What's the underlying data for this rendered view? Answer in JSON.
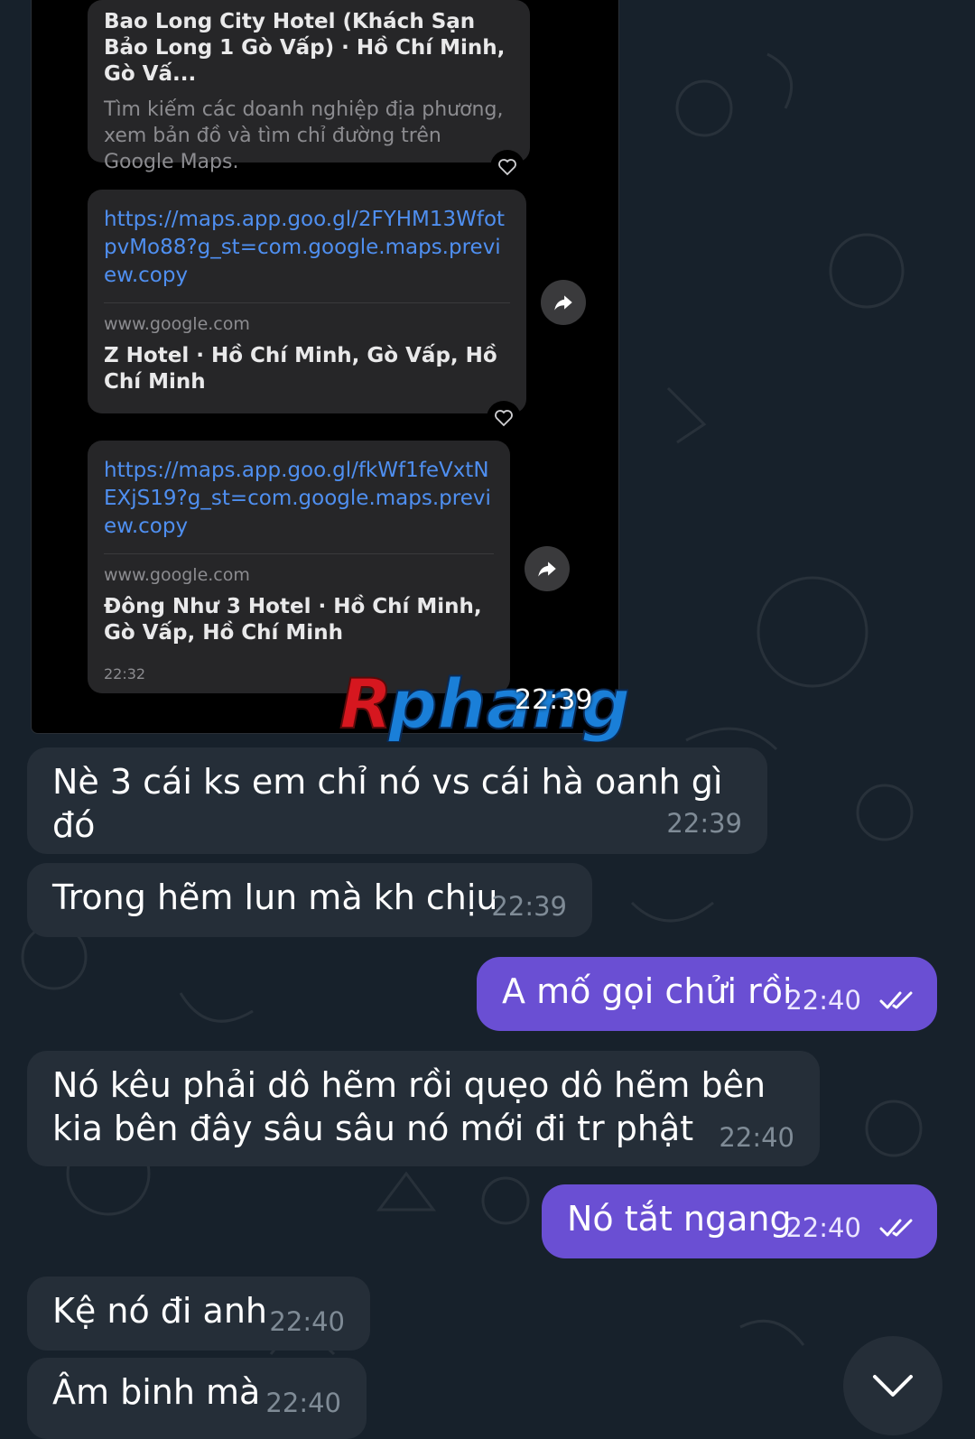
{
  "shared_screenshot": {
    "card1": {
      "title": "Bao Long City Hotel (Khách Sạn Bảo Long 1 Gò Vấp) · Hồ Chí Minh, Gò Vấ...",
      "description": "Tìm kiếm các doanh nghiệp địa phương, xem bản đồ và tìm chỉ đường trên Google Maps."
    },
    "card2": {
      "link": "https://maps.app.goo.gl/2FYHM13WfotpvMo88?g_st=com.google.maps.preview.copy",
      "domain": "www.google.com",
      "title": "Z Hotel · Hồ Chí Minh, Gò Vấp, Hồ Chí Minh"
    },
    "card3": {
      "link": "https://maps.app.goo.gl/fkWf1feVxtNEXjS19?g_st=com.google.maps.preview.copy",
      "domain": "www.google.com",
      "title": "Đông Như 3 Hotel · Hồ Chí Minh, Gò Vấp, Hồ Chí Minh",
      "time": "22:32"
    },
    "overlay_time": "22:39"
  },
  "watermark": {
    "text": "Rphang"
  },
  "messages": [
    {
      "dir": "in",
      "text": "Nè 3 cái ks em chỉ nó vs cái hà oanh gì đó",
      "time": "22:39"
    },
    {
      "dir": "in",
      "text": "Trong hẽm lun mà kh chịu",
      "time": "22:39"
    },
    {
      "dir": "out",
      "text": "A mố gọi chửi rồi",
      "time": "22:40"
    },
    {
      "dir": "in",
      "text": "Nó kêu phải dô hẽm rồi quẹo dô hẽm bên kia bên đây sâu sâu nó mới đi tr phật",
      "time": "22:40"
    },
    {
      "dir": "out",
      "text": "Nó tắt ngang",
      "time": "22:40"
    },
    {
      "dir": "in",
      "text": "Kệ nó đi anh",
      "time": "22:40"
    },
    {
      "dir": "in",
      "text": "Âm binh mà",
      "time": "22:40"
    }
  ],
  "colors": {
    "background": "#17212b",
    "incoming_bubble": "#252e38",
    "outgoing_bubble": "#6a4fd3",
    "link": "#4f8ff0"
  },
  "icons": [
    "heart-icon",
    "share-icon",
    "double-check-icon",
    "chevron-down-icon"
  ]
}
